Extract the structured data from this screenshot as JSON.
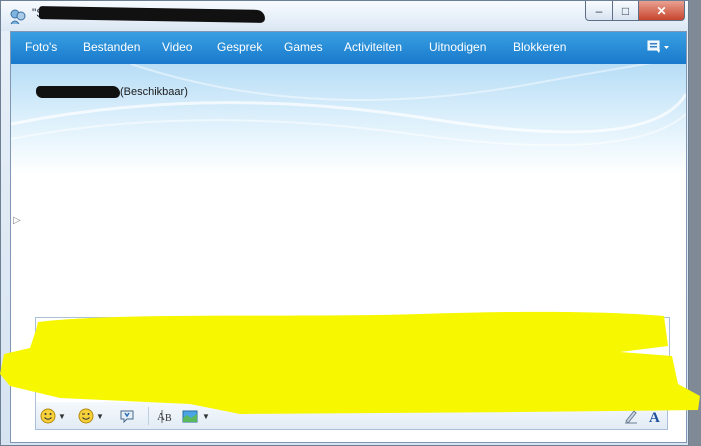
{
  "window": {
    "title": "\"S",
    "controls": {
      "minimize": "–",
      "maximize": "□",
      "close": "✕"
    }
  },
  "menu": {
    "items": [
      "Foto's",
      "Bestanden",
      "Video",
      "Gesprek",
      "Games",
      "Activiteiten",
      "Uitnodigen",
      "Blokkeren"
    ],
    "options_icon": "display-options-icon"
  },
  "contact": {
    "status": "(Beschikbaar)"
  },
  "toolbar": {
    "items": [
      "emoticon-icon",
      "wink-icon",
      "nudge-icon",
      "font-check-icon",
      "background-icon",
      "handwriting-icon",
      "font-icon"
    ]
  },
  "colors": {
    "menubar": "#1e87d4",
    "highlight": "#f7f700",
    "close_button": "#c8452d"
  }
}
